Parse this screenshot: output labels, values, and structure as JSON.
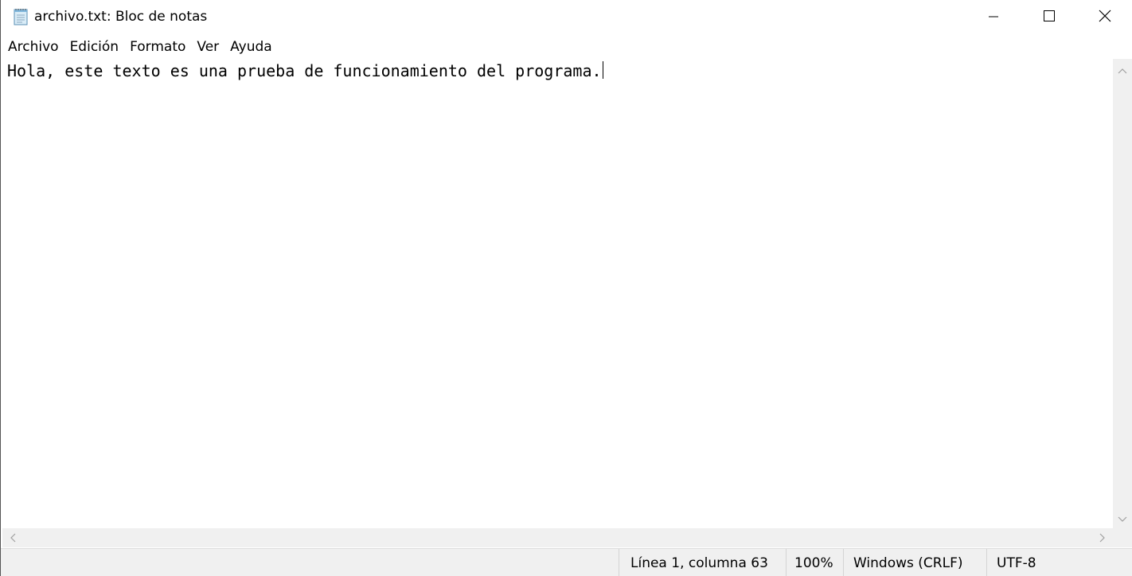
{
  "window": {
    "title": "archivo.txt: Bloc de notas",
    "icon": "notepad-icon"
  },
  "controls": {
    "minimize_icon": "minimize-icon",
    "maximize_icon": "maximize-icon",
    "close_icon": "close-icon"
  },
  "menu": {
    "items": [
      {
        "label": "Archivo"
      },
      {
        "label": "Edición"
      },
      {
        "label": "Formato"
      },
      {
        "label": "Ver"
      },
      {
        "label": "Ayuda"
      }
    ]
  },
  "editor": {
    "content": "Hola, este texto es una prueba de funcionamiento del programa."
  },
  "status": {
    "position": "Línea 1, columna 63",
    "zoom": "100%",
    "line_ending": "Windows (CRLF)",
    "encoding": "UTF-8"
  },
  "colors": {
    "background": "#ffffff",
    "chrome": "#f0f0f0",
    "text": "#000000"
  }
}
